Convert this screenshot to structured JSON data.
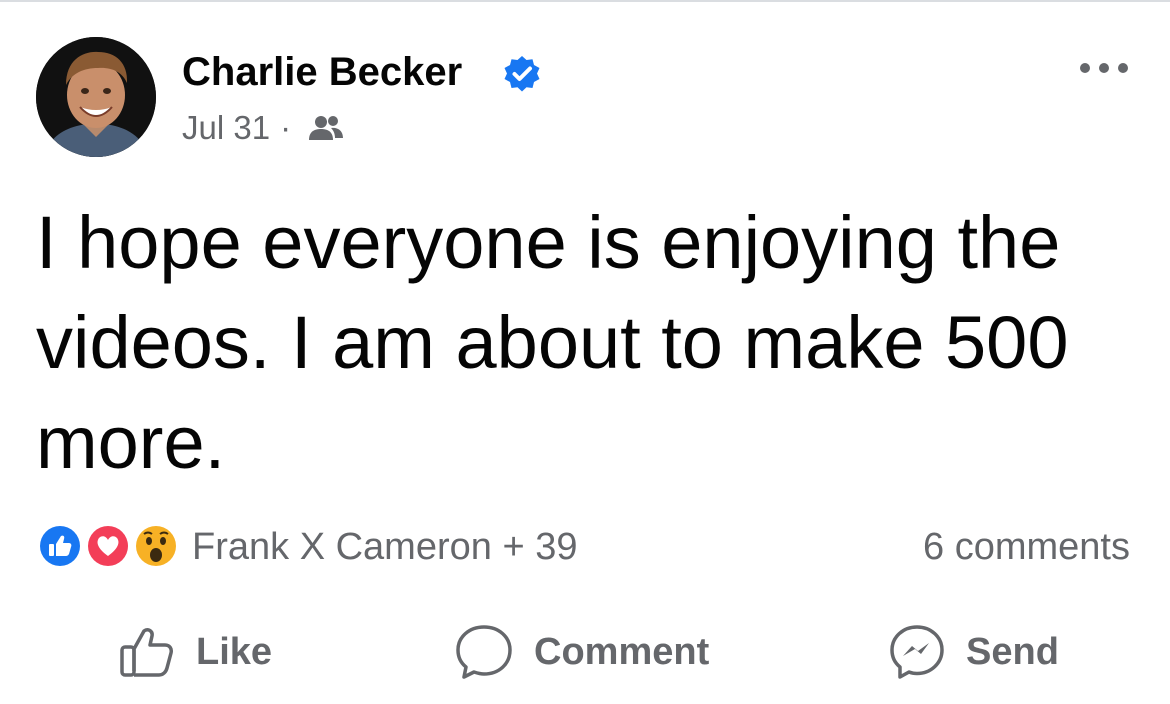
{
  "post": {
    "author": "Charlie Becker",
    "date": "Jul 31",
    "separator": "·",
    "message": "I hope everyone is enjoying the videos. I am about to make 500 more.",
    "reactions_text": "Frank X Cameron + 39",
    "comments_count": "6 comments"
  },
  "actions": {
    "like": "Like",
    "comment": "Comment",
    "send": "Send"
  },
  "icons": {
    "verified": "verified-badge-icon",
    "audience": "friends-icon",
    "more": "more-options-icon",
    "like_reaction": "like-reaction-icon",
    "love_reaction": "love-reaction-icon",
    "wow_reaction": "wow-reaction-icon"
  },
  "colors": {
    "verified": "#1877f2",
    "like_reaction": "#1877f2",
    "love_reaction": "#f33e58",
    "wow_reaction": "#f7b125",
    "secondary_text": "#65676b"
  }
}
